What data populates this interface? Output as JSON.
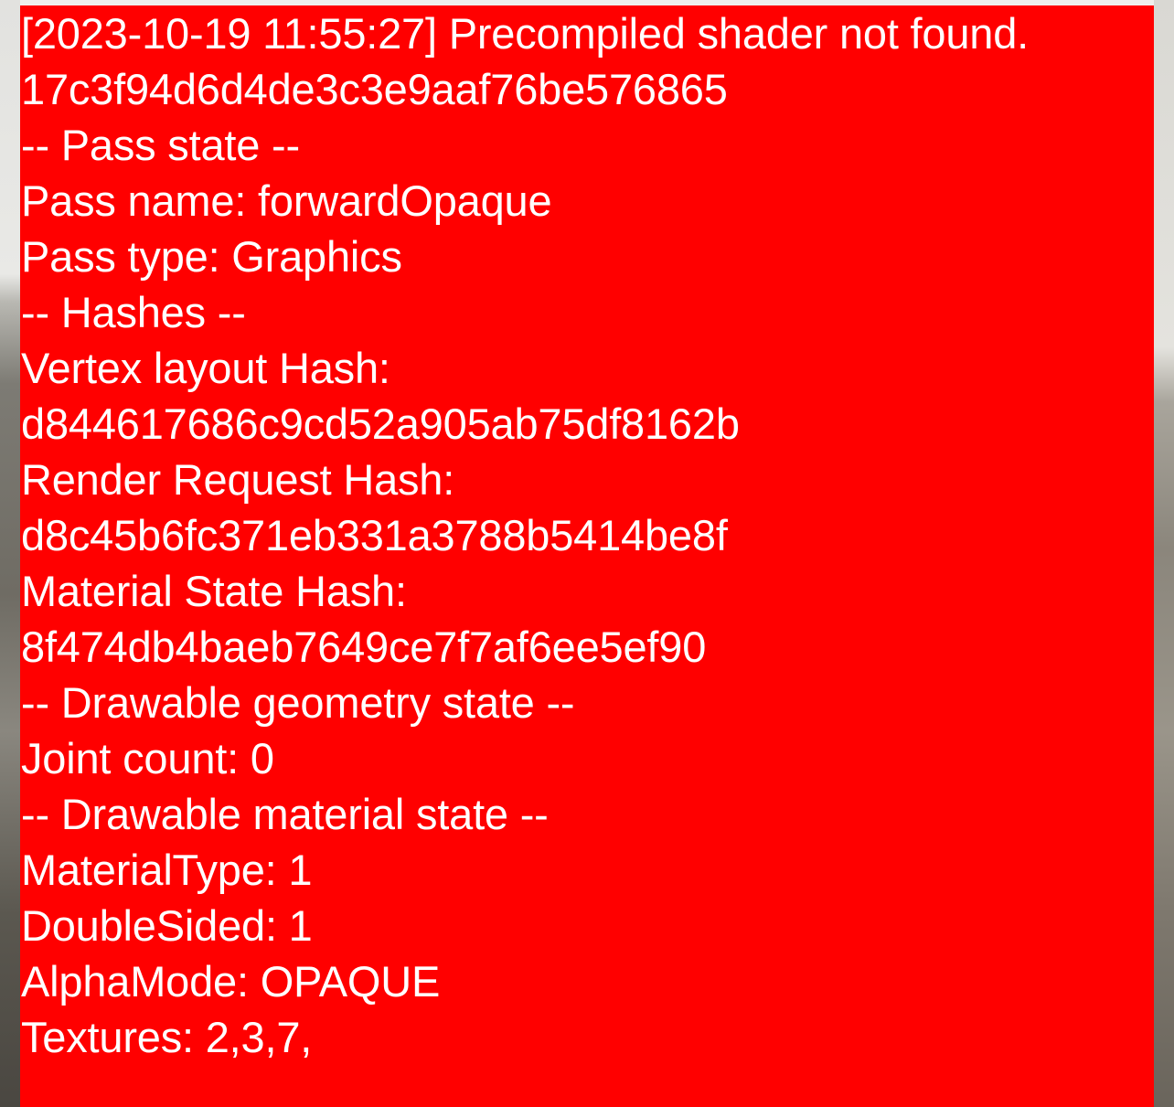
{
  "log": {
    "lines": [
      "[2023-10-19 11:55:27] Precompiled shader not found.",
      "17c3f94d6d4de3c3e9aaf76be576865",
      "-- Pass state --",
      "Pass name: forwardOpaque",
      "Pass type: Graphics",
      "-- Hashes --",
      "Vertex layout Hash:",
      "d844617686c9cd52a905ab75df8162b",
      "Render Request Hash:",
      "d8c45b6fc371eb331a3788b5414be8f",
      "Material State Hash:",
      "8f474db4baeb7649ce7f7af6ee5ef90",
      "-- Drawable geometry state --",
      "Joint count: 0",
      "-- Drawable material state --",
      "MaterialType: 1",
      "DoubleSided: 1",
      "AlphaMode: OPAQUE",
      "Textures: 2,3,7,"
    ]
  },
  "colors": {
    "panel_background": "#ff0000",
    "text": "#ffffff"
  }
}
